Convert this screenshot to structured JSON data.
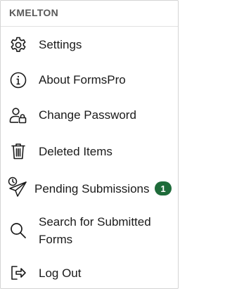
{
  "header": {
    "title": "KMELTON"
  },
  "items": [
    {
      "label": "Settings",
      "icon": "gear-icon"
    },
    {
      "label": "About FormsPro",
      "icon": "info-icon"
    },
    {
      "label": "Change Password",
      "icon": "user-lock-icon"
    },
    {
      "label": "Deleted Items",
      "icon": "trash-icon"
    },
    {
      "label": "Pending Submissions",
      "icon": "clock-send-icon",
      "badge": "1"
    },
    {
      "label": "Search for Submitted Forms",
      "icon": "search-icon"
    },
    {
      "label": "Log Out",
      "icon": "logout-icon"
    }
  ],
  "colors": {
    "badge": "#1e6b3a",
    "header_text": "#595959",
    "divider": "#e2e2e2"
  }
}
